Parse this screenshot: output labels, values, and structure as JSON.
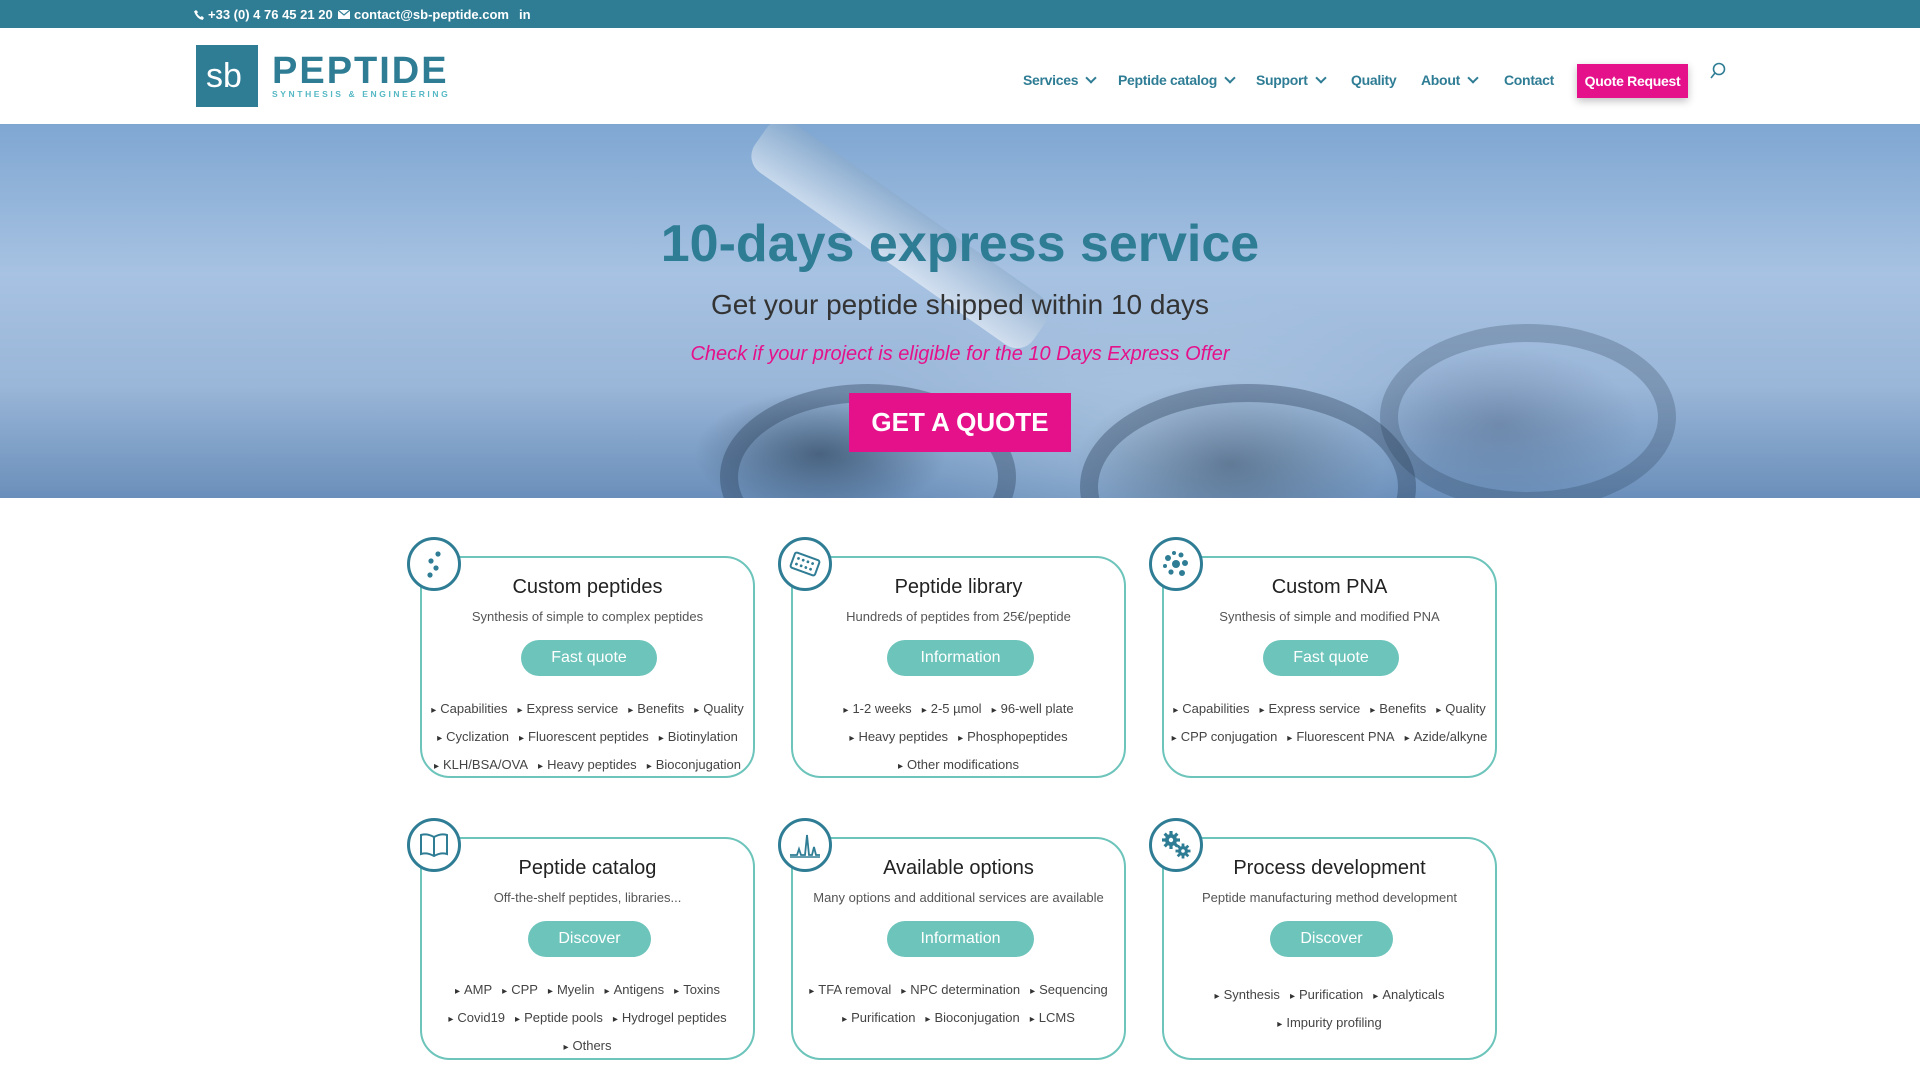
{
  "topbar": {
    "phone": "+33 (0) 4 76 45 21 20",
    "email": "contact@sb-peptide.com",
    "linkedin": "in"
  },
  "logo": {
    "mark": "sb",
    "name": "PEPTIDE",
    "tagline": "SYNTHESIS & ENGINEERING"
  },
  "nav": {
    "items": [
      {
        "label": "Services",
        "dropdown": true
      },
      {
        "label": "Peptide catalog",
        "dropdown": true
      },
      {
        "label": "Support",
        "dropdown": true
      },
      {
        "label": "Quality",
        "dropdown": false
      },
      {
        "label": "About",
        "dropdown": true
      },
      {
        "label": "Contact",
        "dropdown": false
      }
    ],
    "quote_button": "Quote Request",
    "search_icon": "search-icon"
  },
  "hero": {
    "title": "10-days express service",
    "subtitle": "Get your peptide shipped within 10 days",
    "link": "Check if your project is eligible for the 10 Days Express Offer",
    "button": "GET A QUOTE"
  },
  "cards": [
    {
      "icon": "molecule-chain-icon",
      "title": "Custom peptides",
      "subtitle": "Synthesis of simple to complex peptides",
      "button": "Fast quote",
      "rows": [
        [
          "Capabilities",
          "Express service",
          "Benefits",
          "Quality"
        ],
        [
          "Cyclization",
          "Fluorescent peptides",
          "Biotinylation"
        ],
        [
          "KLH/BSA/OVA",
          "Heavy peptides",
          "Bioconjugation"
        ]
      ]
    },
    {
      "icon": "well-plate-icon",
      "title": "Peptide library",
      "subtitle": "Hundreds of peptides from 25€/peptide",
      "button": "Information",
      "rows": [
        [
          "1-2 weeks",
          "2-5 µmol",
          "96-well plate"
        ],
        [
          "Heavy peptides",
          "Phosphopeptides"
        ],
        [
          "Other modifications"
        ]
      ]
    },
    {
      "icon": "dots-cluster-icon",
      "title": "Custom PNA",
      "subtitle": "Synthesis of simple and modified PNA",
      "button": "Fast quote",
      "rows": [
        [
          "Capabilities",
          "Express service",
          "Benefits",
          "Quality"
        ],
        [
          "CPP conjugation",
          "Fluorescent PNA",
          "Azide/alkyne"
        ]
      ]
    },
    {
      "icon": "open-book-icon",
      "title": "Peptide catalog",
      "subtitle": "Off-the-shelf peptides, libraries...",
      "button": "Discover",
      "rows": [
        [
          "AMP",
          "CPP",
          "Myelin",
          "Antigens",
          "Toxins"
        ],
        [
          "Covid19",
          "Peptide pools",
          "Hydrogel peptides"
        ],
        [
          "Others"
        ]
      ]
    },
    {
      "icon": "chromatogram-icon",
      "title": "Available options",
      "subtitle": "Many options and additional services are available",
      "button": "Information",
      "rows": [
        [
          "TFA removal",
          "NPC determination",
          "Sequencing"
        ],
        [
          "Purification",
          "Bioconjugation",
          "LCMS"
        ]
      ]
    },
    {
      "icon": "gears-icon",
      "title": "Process development",
      "subtitle": "Peptide manufacturing method development",
      "button": "Discover",
      "rows": [
        [
          "Synthesis",
          "Purification",
          "Analyticals"
        ],
        [
          "Impurity profiling"
        ]
      ]
    }
  ],
  "colors": {
    "brand": "#2f7d95",
    "accent": "#e5118b",
    "teal": "#6cc4bb"
  }
}
